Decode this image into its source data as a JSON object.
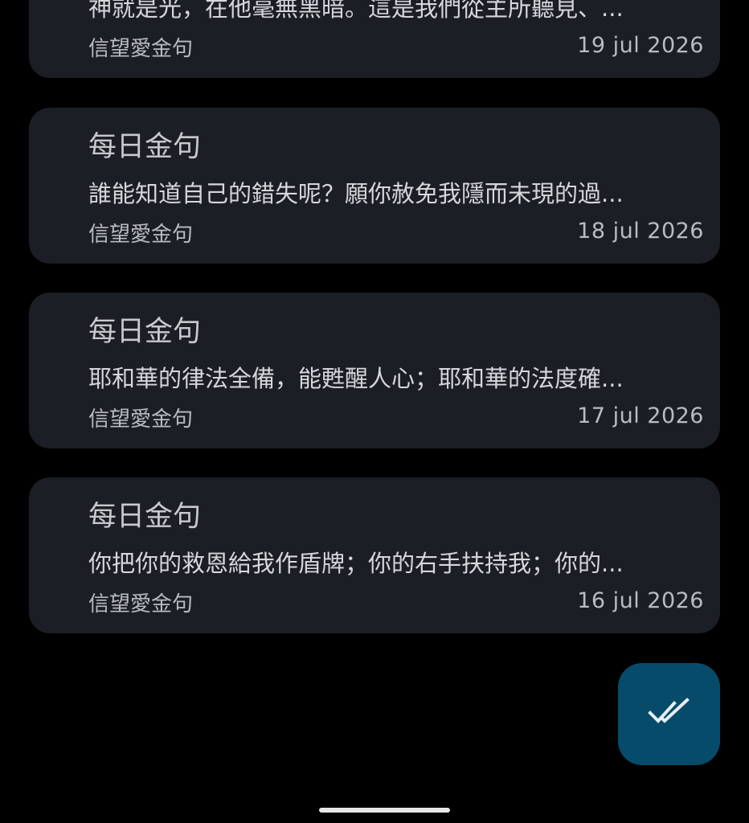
{
  "notifications": [
    {
      "title": "",
      "body": "神就是光，在他毫無黑暗。這是我們從主所聽見、...",
      "app": "信望愛金句",
      "date": "19 jul 2026"
    },
    {
      "title": "每日金句",
      "body": "誰能知道自己的錯失呢？願你赦免我隱而未現的過...",
      "app": "信望愛金句",
      "date": "18 jul 2026"
    },
    {
      "title": "每日金句",
      "body": "耶和華的律法全備，能甦醒人心；耶和華的法度確...",
      "app": "信望愛金句",
      "date": "17 jul 2026"
    },
    {
      "title": "每日金句",
      "body": "你把你的救恩給我作盾牌；你的右手扶持我；你的...",
      "app": "信望愛金句",
      "date": "16 jul 2026"
    }
  ],
  "fab": {
    "icon": "double-check-icon"
  },
  "colors": {
    "background": "#000000",
    "card": "#1b1e24",
    "fab": "#064c6a",
    "fab_icon": "#e8eef2"
  }
}
